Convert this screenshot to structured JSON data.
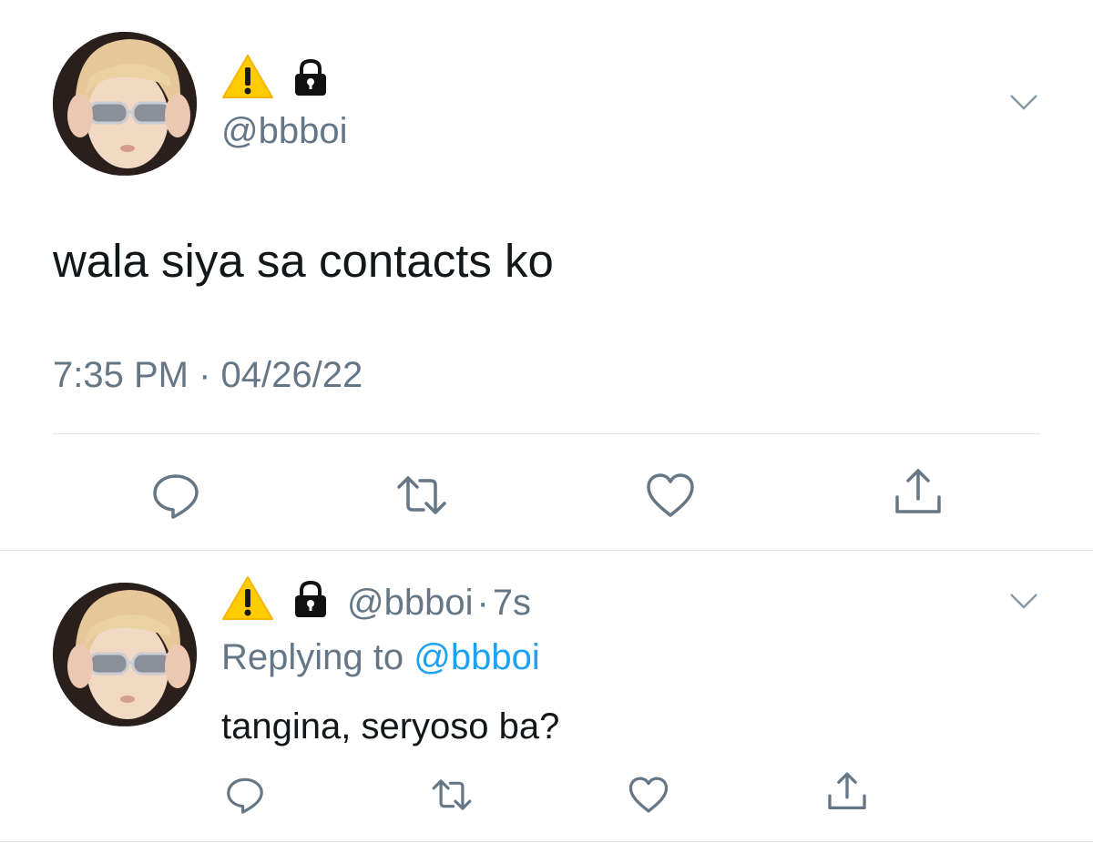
{
  "main_tweet": {
    "name_emojis": [
      "⚠",
      "🔒"
    ],
    "handle": "@bbboi",
    "text": "wala siya sa contacts ko",
    "timestamp": "7:35 PM · 04/26/22",
    "actions": [
      "reply-icon",
      "retweet-icon",
      "like-icon",
      "share-icon"
    ]
  },
  "reply_tweet": {
    "name_emojis": [
      "⚠",
      "🔒"
    ],
    "handle": "@bbboi",
    "separator": "·",
    "age": "7s",
    "replying_prefix": "Replying to",
    "replying_handle": "@bbboi",
    "text": "tangina, seryoso ba?",
    "actions": [
      "reply-icon",
      "retweet-icon",
      "like-icon",
      "share-icon"
    ]
  },
  "colors": {
    "secondary_text": "#657786",
    "primary_text": "#14171a",
    "link": "#1da1f2",
    "divider": "#e1e8ed",
    "warning_yellow": "#ffcc00"
  }
}
